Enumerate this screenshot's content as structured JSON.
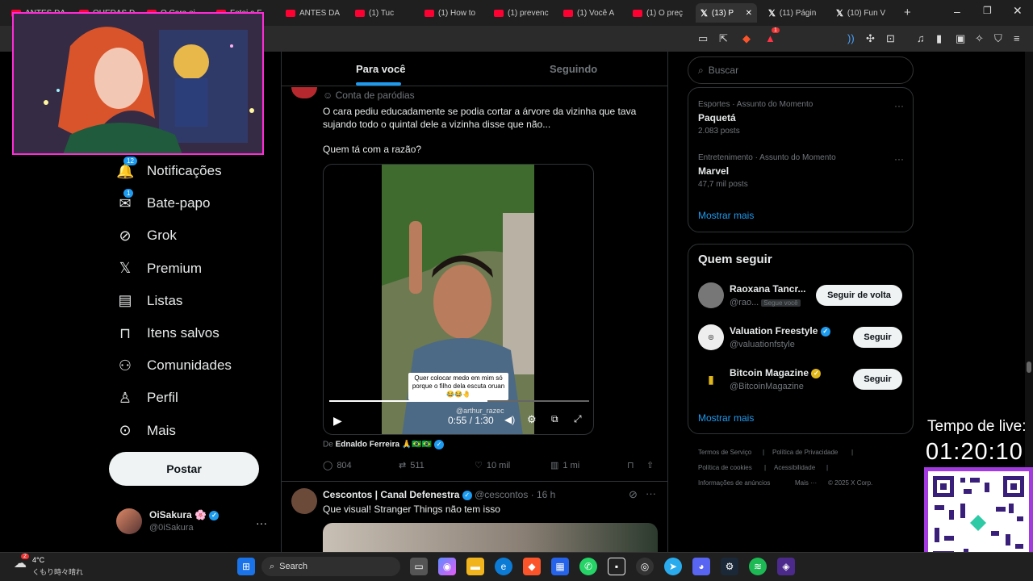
{
  "browser": {
    "tabs": [
      {
        "label": "ANTES DA",
        "kind": "yt"
      },
      {
        "label": "QUEDAS D",
        "kind": "yt"
      },
      {
        "label": "O Cara ei",
        "kind": "yt"
      },
      {
        "label": "Fotei a F",
        "kind": "yt"
      },
      {
        "label": "ANTES DA",
        "kind": "yt"
      },
      {
        "label": "(1) Tuc",
        "kind": "yt"
      },
      {
        "label": "(1) How to",
        "kind": "yt"
      },
      {
        "label": "(1) prevenc",
        "kind": "yt"
      },
      {
        "label": "(1) Você A",
        "kind": "yt"
      },
      {
        "label": "(1) O preç",
        "kind": "yt"
      },
      {
        "label": "(13) P",
        "kind": "x"
      },
      {
        "label": "(11) Págin",
        "kind": "x"
      },
      {
        "label": "(10) Fun V",
        "kind": "x"
      }
    ],
    "new_tab": "+",
    "shields_count": "1"
  },
  "nav": {
    "items": [
      {
        "label": "Notificações",
        "icon": "bell-icon",
        "badge": "12"
      },
      {
        "label": "Bate-papo",
        "icon": "mail-icon",
        "badge": "1"
      },
      {
        "label": "Grok",
        "icon": "grok-icon"
      },
      {
        "label": "Premium",
        "icon": "x-logo-icon"
      },
      {
        "label": "Listas",
        "icon": "list-icon"
      },
      {
        "label": "Itens salvos",
        "icon": "bookmark-icon"
      },
      {
        "label": "Comunidades",
        "icon": "communities-icon"
      },
      {
        "label": "Perfil",
        "icon": "person-icon"
      },
      {
        "label": "Mais",
        "icon": "more-circle-icon"
      }
    ],
    "post_label": "Postar",
    "account": {
      "name": "OiSakura 🌸",
      "handle": "@0iSakura"
    }
  },
  "feed": {
    "tabs": [
      "Para você",
      "Seguindo"
    ],
    "post1": {
      "label": "Conta de paródias",
      "text1": "O cara pediu educadamente se podia cortar a árvore da vizinha que tava sujando todo o quintal dele a vizinha disse que não...",
      "text2": "Quem tá com a razão?",
      "caption": "Quer colocar medo em mim só porque o filho dela escuta oruan 😂😂🤚",
      "watermark": "@arthur_razec",
      "time": "0:55 / 1:30",
      "progress": 0.61,
      "from_prefix": "De",
      "from_name": "Ednaldo Ferreira 🙏🇧🇷🇧🇷",
      "stats": {
        "replies": "804",
        "reposts": "511",
        "likes": "10 mil",
        "views": "1 mi"
      }
    },
    "post2": {
      "name": "Cescontos | Canal Defenestra",
      "handle": "@cescontos · 16 h",
      "text": "Que visual! Stranger Things não tem isso"
    }
  },
  "right": {
    "search_placeholder": "Buscar",
    "trends": [
      {
        "meta": "Esportes · Assunto do Momento",
        "title": "Paquetá",
        "count": "2.083 posts"
      },
      {
        "meta": "Entretenimento · Assunto do Momento",
        "title": "Marvel",
        "count": "47,7 mil posts"
      }
    ],
    "show_more": "Mostrar mais",
    "who_title": "Quem seguir",
    "who": [
      {
        "name": "Raoxana Tancr...",
        "handle": "@rao...",
        "tag": "Segue você",
        "button": "Seguir de volta"
      },
      {
        "name": "Valuation Freestyle",
        "handle": "@valuationfstyle",
        "button": "Seguir"
      },
      {
        "name": "Bitcoin Magazine",
        "handle": "@BitcoinMagazine",
        "button": "Seguir"
      }
    ],
    "who_more": "Mostrar mais",
    "footer": [
      "Termos de Serviço",
      "|",
      "Política de Privacidade",
      "|",
      "Política de cookies",
      "|",
      "Acessibilidade",
      "|",
      "Informações de anúncios",
      "Mais ···",
      "© 2025 X Corp."
    ]
  },
  "overlay": {
    "timer_label": "Tempo de live:",
    "timer_value": "01:20:10"
  },
  "taskbar": {
    "weather_temp": "4°C",
    "weather_desc": "くもり時々晴れ",
    "weather_badge": "2",
    "search": "Search"
  }
}
